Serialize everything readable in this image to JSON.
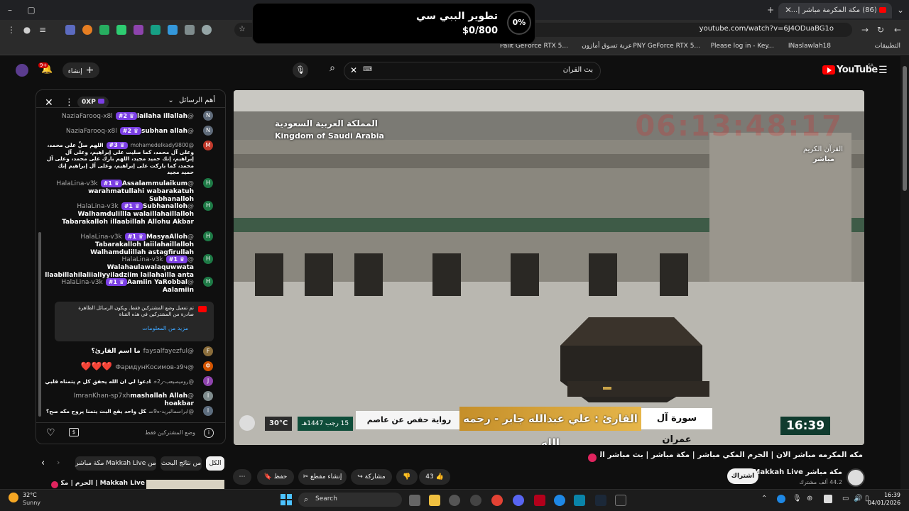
{
  "browser": {
    "tab_title": "مكة المكرمة مباشر |...",
    "tab_count": "(86)",
    "url": "youtube.com/watch?v=6J4ODuaBG1o",
    "bookmarks": [
      "التطبيقات",
      "INaslawlah18",
      "Please log in - Key...",
      "PNY GeForce RTX 5...",
      "عربة تسوق أمازون",
      "Palit GeForce RTX 5..."
    ]
  },
  "toast": {
    "title": "تطوير الببي سي",
    "amount": "$0/800",
    "percent": "0%"
  },
  "youtube": {
    "logo": "YouTube",
    "region": "SA",
    "search_query": "بث القران",
    "create_label": "إنشاء",
    "notif_badge": "9+"
  },
  "chat": {
    "header_title": "أهم الرسائل",
    "points": "0XP",
    "messages": [
      {
        "author": "@NaziaFarooq-x8l",
        "badge": "#2",
        "text": "lailaha illallah",
        "initial": "N",
        "color": "#5f6b7a"
      },
      {
        "author": "@NaziaFarooq-x8l",
        "badge": "#2",
        "text": "subhan allah",
        "initial": "N",
        "color": "#5f6b7a"
      },
      {
        "author": "@mohamedelkady9800",
        "badge": "#3",
        "text": "اللهم صلِّ على محمد، وعلى آل محمد، كما صليت على إبراهيم، وعلى آل إبراهيم، إنك حميد مجيد، اللهم بارك على محمد، وعلى آل محمد، كما باركت على إبراهيم، وعلى آل إبراهيم إنك حميد مجيد",
        "initial": "M",
        "color": "#c0392b"
      },
      {
        "author": "@HalaLina-v3k",
        "badge": "#1",
        "text": "Assalammulaikum warahmatullahi wabarakatuh Subhanalloh",
        "initial": "H",
        "color": "#1e7a46"
      },
      {
        "author": "@HalaLina-v3k",
        "badge": "#1",
        "text": "Subhanalloh Walhamdulillla walaillahaillalloh Tabarakalloh illaabillah Allohu Akbar",
        "initial": "H",
        "color": "#1e7a46"
      },
      {
        "author": "@HalaLina-v3k",
        "badge": "#1",
        "text": "MasyaAlloh Tabarakalloh laiilahaillalloh Walhamdulillah astagfirullah",
        "initial": "H",
        "color": "#1e7a46"
      },
      {
        "author": "@HalaLina-v3k",
        "badge": "#1",
        "text": "Walahaulawalaquwwata llaabillahilaliialiyyiladziim lailahailla anta",
        "initial": "H",
        "color": "#1e7a46"
      },
      {
        "author": "@HalaLina-v3k",
        "badge": "#1",
        "text": "Aamiin YaRobbal Aalamiin",
        "initial": "H",
        "color": "#1e7a46"
      }
    ],
    "notice_text": "تم تفعيل وضع المشتركين فقط. ويكون الرسائل الظاهرة صادرة من المشتركين في هذه القناة",
    "notice_link": "مزيد من المعلومات",
    "messages2": [
      {
        "author": "@faysalfayezful",
        "text": "ما اسم القارئ؟",
        "initial": "F",
        "color": "#8a6d3b"
      },
      {
        "author": "@ФаридунКосимов-з9ч",
        "text": "❤️❤️❤️",
        "initial": "Ф",
        "color": "#d35400"
      },
      {
        "author": "@روميصيعب-ر2خ",
        "text": "ادعوا لي ان الله يحقق كل م يتمناه قلبي",
        "initial": "J",
        "color": "#8e44ad"
      },
      {
        "author": "@ImranKhan-sp7xh",
        "text": "mashallah Allah hoakbar",
        "initial": "I",
        "color": "#7f8c8d"
      },
      {
        "author": "@ابراسمالبريد-ه9س",
        "text": "كل واحد يقع البث يتمنا يروح مكه صح؟",
        "initial": "ا",
        "color": "#5d6d7e"
      }
    ],
    "input_placeholder": "وضع المشتركين فقط"
  },
  "video": {
    "overlay_ar": "المملكة العربية السعودية",
    "overlay_en": "Kingdom of Saudi Arabia",
    "channel_logo": "القرآن الكريم",
    "live_label": "مباشر",
    "clock_bg": "06:13:48:17",
    "surah": "سورة آل عمران",
    "reader": "القارئ : علي عبدالله جابر - رحمه الله",
    "riwaya": "رواية حفص عن عاصم",
    "hijri_date": "15 رجب 1447هـ",
    "temp": "30°C",
    "time": "16:39",
    "accent": "#e6b64a"
  },
  "below": {
    "title": "مكه المكرمه مباشر الان | الحرم المكي مباشر | مكة مباشر | بث مباشر الحرم المكي",
    "channel": "Makkah Live",
    "channel_ar": "مكة مباشر",
    "subs": "44.2 ألف مشترك",
    "subscribe": "اشتراك",
    "likes": "43",
    "share": "مشاركة",
    "clip": "إنشاء مقطع",
    "save": "حفظ",
    "chips": [
      "الكل",
      "من نتائج البحث",
      "من Makkah Live مكة مباشر"
    ],
    "next_title": "Makkah Live | الحرم | مكة مباشر"
  },
  "taskbar": {
    "weather_temp": "32°C",
    "weather_desc": "Sunny",
    "search": "Search",
    "time": "16:39",
    "date": "04/01/2026"
  }
}
